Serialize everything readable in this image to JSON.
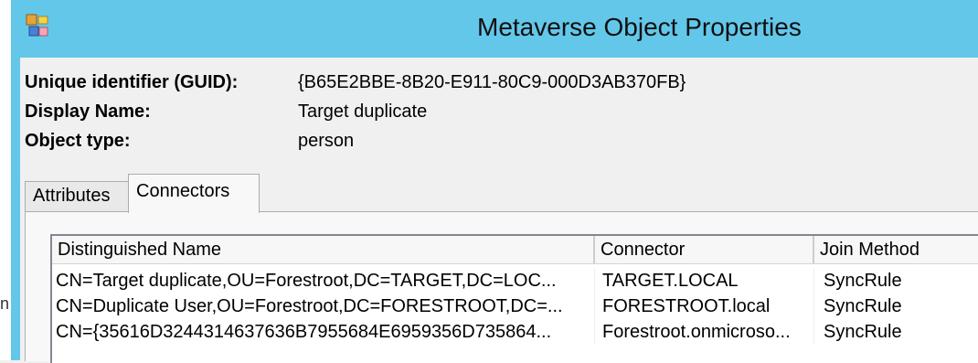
{
  "window": {
    "title": "Metaverse Object Properties",
    "icon": "metaverse-icon",
    "accent": "#63c7ea"
  },
  "left_fragment": "n",
  "properties": {
    "guid_label": "Unique identifier (GUID):",
    "guid_value": "{B65E2BBE-8B20-E911-80C9-000D3AB370FB}",
    "display_name_label": "Display Name:",
    "display_name_value": "Target duplicate",
    "object_type_label": "Object type:",
    "object_type_value": "person"
  },
  "tabs": [
    {
      "label": "Attributes",
      "selected": false
    },
    {
      "label": "Connectors",
      "selected": true
    }
  ],
  "connectors": {
    "columns": [
      "Distinguished Name",
      "Connector",
      "Join Method"
    ],
    "rows": [
      [
        "CN=Target duplicate,OU=Forestroot,DC=TARGET,DC=LOC...",
        "TARGET.LOCAL",
        "SyncRule"
      ],
      [
        "CN=Duplicate User,OU=Forestroot,DC=FORESTROOT,DC=...",
        "FORESTROOT.local",
        "SyncRule"
      ],
      [
        "CN={35616D3244314637636B7955684E6959356D735864...",
        "Forestroot.onmicroso...",
        "SyncRule"
      ]
    ]
  }
}
